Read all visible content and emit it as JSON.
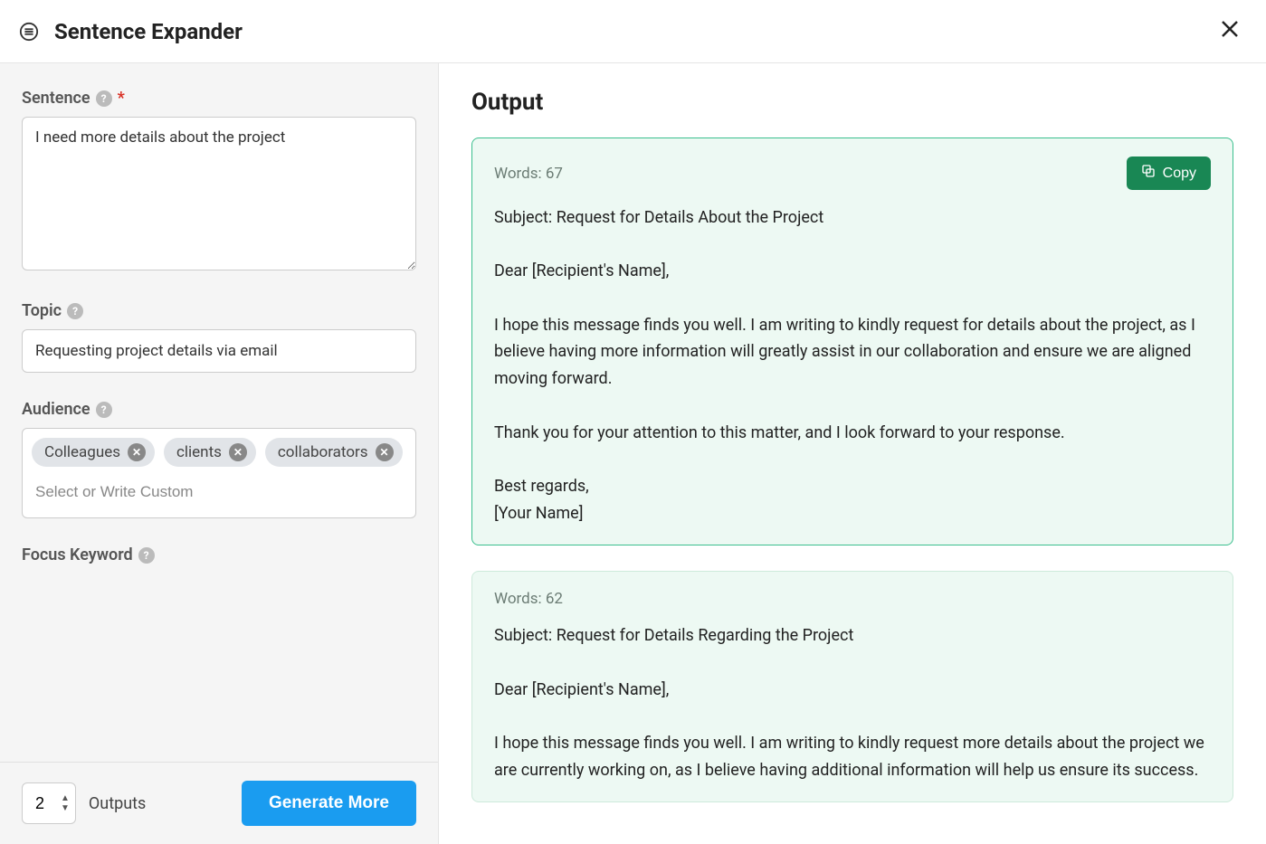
{
  "header": {
    "title": "Sentence Expander"
  },
  "form": {
    "sentenceLabel": "Sentence",
    "sentenceValue": "I need more details about the project",
    "topicLabel": "Topic",
    "topicValue": "Requesting project details via email",
    "audienceLabel": "Audience",
    "audienceTags": [
      "Colleagues",
      "clients",
      "collaborators"
    ],
    "audiencePlaceholder": "Select or Write Custom",
    "focusKeywordLabel": "Focus Keyword",
    "outputsCount": "2",
    "outputsLabel": "Outputs",
    "generateLabel": "Generate More"
  },
  "output": {
    "heading": "Output",
    "copyLabel": "Copy",
    "results": [
      {
        "wordCount": "Words: 67",
        "body": "Subject: Request for Details About the Project\n\nDear [Recipient's Name],\n\nI hope this message finds you well. I am writing to kindly request for details about the project, as I believe having more information will greatly assist in our collaboration and ensure we are aligned moving forward.\n\nThank you for your attention to this matter, and I look forward to your response.\n\nBest regards,\n[Your Name]"
      },
      {
        "wordCount": "Words: 62",
        "body": "Subject: Request for Details Regarding the Project\n\nDear [Recipient's Name],\n\nI hope this message finds you well. I am writing to kindly request more details about the project we are currently working on, as I believe having additional information will help us ensure its success."
      }
    ]
  }
}
